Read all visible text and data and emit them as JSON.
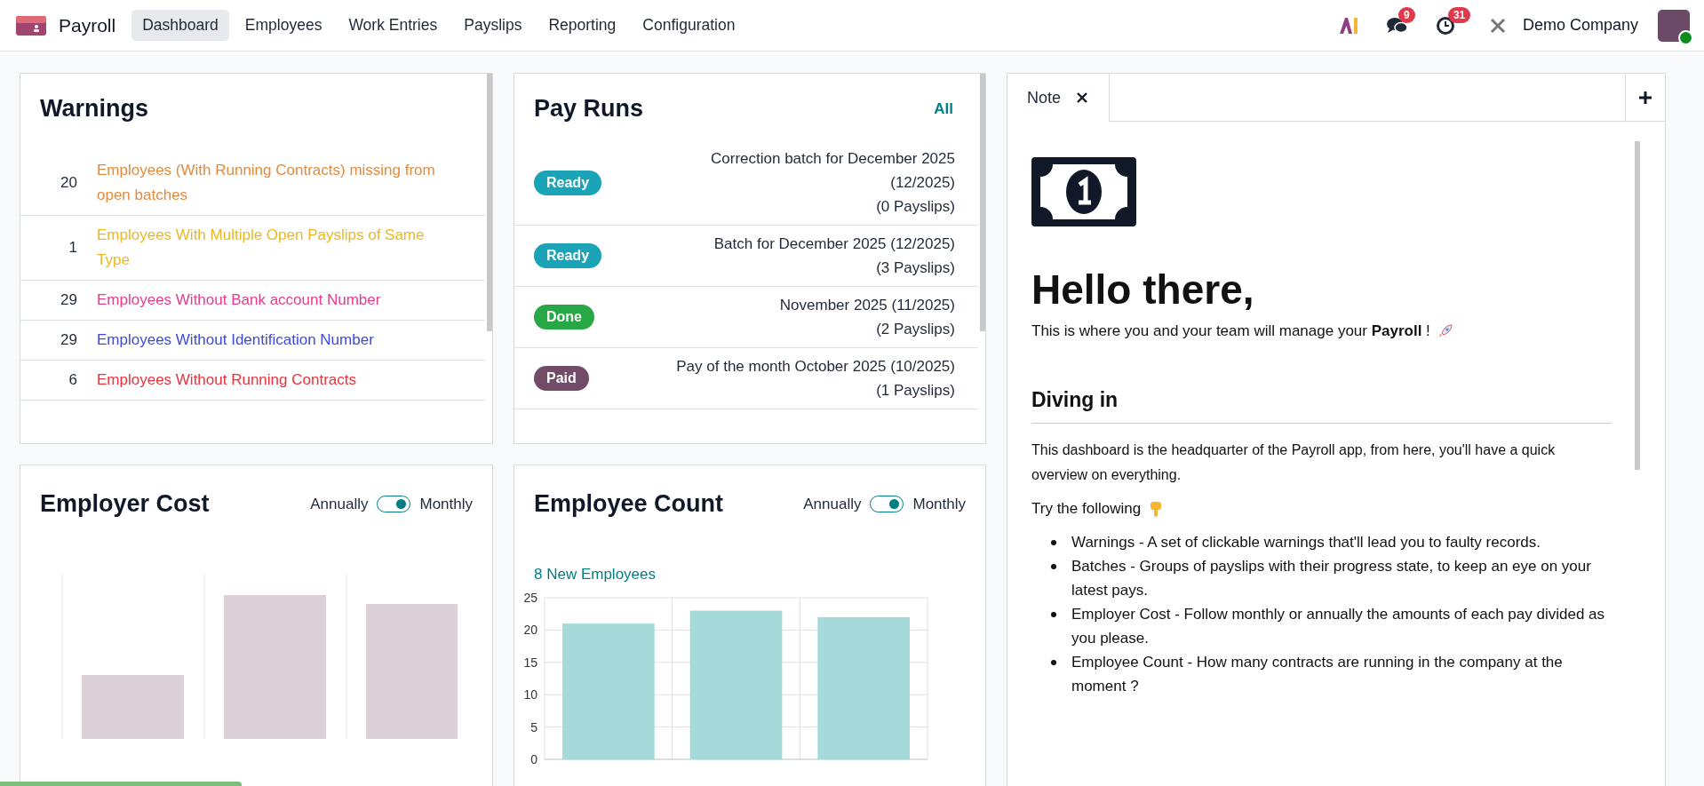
{
  "app": {
    "name": "Payroll"
  },
  "nav": [
    {
      "label": "Dashboard",
      "selected": true
    },
    {
      "label": "Employees",
      "selected": false
    },
    {
      "label": "Work Entries",
      "selected": false
    },
    {
      "label": "Payslips",
      "selected": false
    },
    {
      "label": "Reporting",
      "selected": false
    },
    {
      "label": "Configuration",
      "selected": false
    }
  ],
  "systray": {
    "messages_count": "9",
    "activities_count": "31",
    "company": "Demo Company"
  },
  "warnings": {
    "title": "Warnings",
    "items": [
      {
        "count": "20",
        "label": "Employees (With Running Contracts) missing from open batches",
        "color": "#e08b3e"
      },
      {
        "count": "1",
        "label": "Employees With Multiple Open Payslips of Same Type",
        "color": "#e9b824"
      },
      {
        "count": "29",
        "label": "Employees Without Bank account Number",
        "color": "#e63c8c"
      },
      {
        "count": "29",
        "label": "Employees Without Identification Number",
        "color": "#3d49e0"
      },
      {
        "count": "6",
        "label": "Employees Without Running Contracts",
        "color": "#e8323c"
      }
    ]
  },
  "pay_runs": {
    "title": "Pay Runs",
    "link": "All",
    "items": [
      {
        "status": "Ready",
        "color": "#1ba3b7",
        "lines": [
          "Correction batch for December 2025",
          "(12/2025)",
          "(0 Payslips)"
        ]
      },
      {
        "status": "Ready",
        "color": "#1ba3b7",
        "lines": [
          "Batch for December 2025 (12/2025)",
          "(3 Payslips)"
        ]
      },
      {
        "status": "Done",
        "color": "#28a745",
        "lines": [
          "November 2025 (11/2025)",
          "(2 Payslips)"
        ]
      },
      {
        "status": "Paid",
        "color": "#714b67",
        "lines": [
          "Pay of the month October 2025 (10/2025)",
          "(1 Payslips)"
        ]
      }
    ]
  },
  "employer_cost": {
    "title": "Employer Cost",
    "toggle": {
      "left": "Annually",
      "right": "Monthly",
      "on": true
    }
  },
  "employee_count": {
    "title": "Employee Count",
    "toggle": {
      "left": "Annually",
      "right": "Monthly",
      "on": true
    },
    "link": "8 New Employees",
    "chart_data": {
      "type": "bar",
      "values": [
        21,
        23,
        22
      ],
      "ylim": [
        0,
        25
      ],
      "yticks": [
        0,
        5,
        10,
        15,
        20,
        25
      ],
      "grid": true
    }
  },
  "note": {
    "tab": "Note",
    "heading": "Hello there,",
    "intro": "This is where you and your team will manage your **Payroll** !",
    "section": "Diving in",
    "paragraph": "This dashboard is the headquarter of the Payroll app, from here, you'll have a quick overview on everything.",
    "try": "Try the following",
    "bullets": [
      "Warnings - A set of clickable warnings that'll lead you to faulty records.",
      "Batches - Groups of payslips with their progress state, to keep an eye on your latest pays.",
      "Employer Cost - Follow monthly or annually the amounts of each pay divided as you please.",
      "Employee Count - How many contracts are running in the company at the moment ?"
    ]
  }
}
